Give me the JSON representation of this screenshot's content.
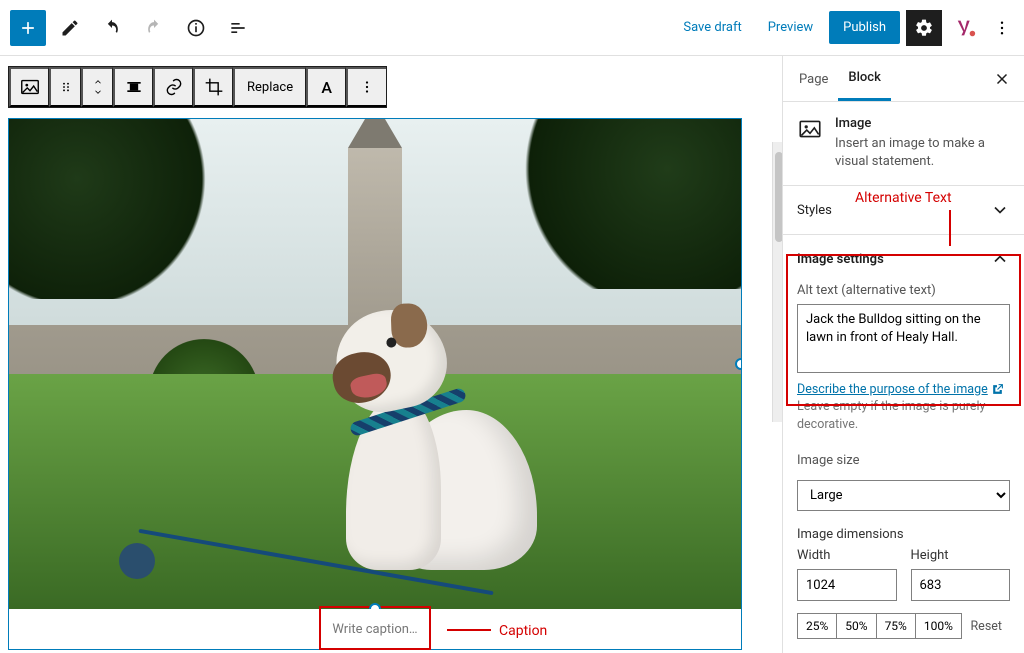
{
  "topbar": {
    "save_draft": "Save draft",
    "preview": "Preview",
    "publish": "Publish"
  },
  "block_toolbar": {
    "replace": "Replace"
  },
  "caption": {
    "placeholder": "Write caption…",
    "annotation": "Caption"
  },
  "sidebar": {
    "tabs": {
      "page": "Page",
      "block": "Block"
    },
    "block_info": {
      "title": "Image",
      "desc": "Insert an image to make a visual statement."
    },
    "sections": {
      "styles": "Styles",
      "image_settings": "Image settings"
    },
    "alt": {
      "annotation": "Alternative Text",
      "label": "Alt text (alternative text)",
      "value": "Jack the Bulldog sitting on the lawn in front of Healy Hall.",
      "link_text": "Describe the purpose of the image",
      "hint_tail": " Leave empty if the image is purely decorative."
    },
    "image_size": {
      "label": "Image size",
      "value": "Large"
    },
    "dimensions": {
      "header": "Image dimensions",
      "width_label": "Width",
      "height_label": "Height",
      "width": "1024",
      "height": "683",
      "pct": [
        "25%",
        "50%",
        "75%",
        "100%"
      ],
      "reset": "Reset"
    }
  }
}
